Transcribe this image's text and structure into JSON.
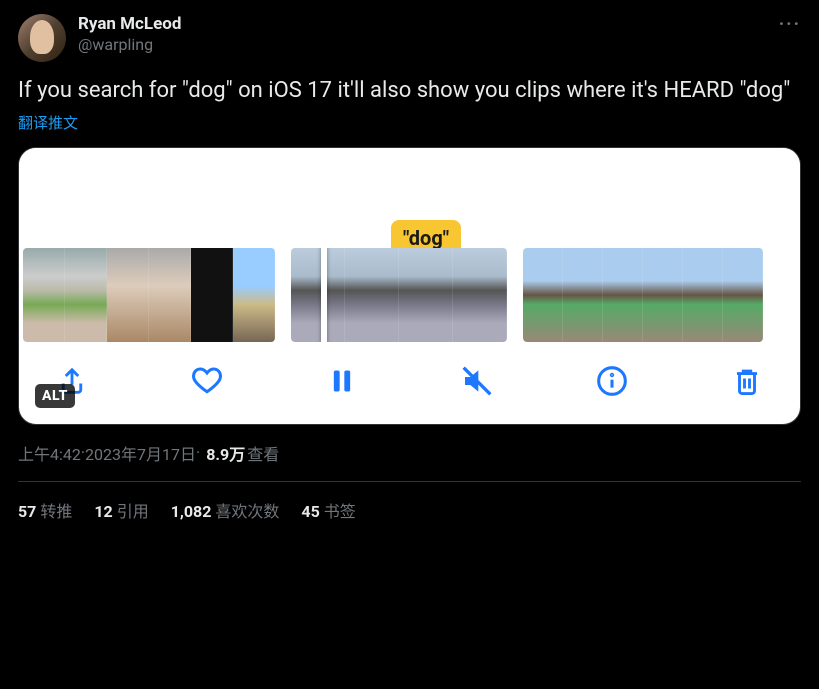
{
  "user": {
    "display_name": "Ryan McLeod",
    "handle": "@warpling"
  },
  "more_glyph": "···",
  "body": "If you search for \"dog\" on iOS 17 it'll also show you clips where it's HEARD \"dog\"",
  "translate": "翻译推文",
  "media": {
    "search_pill": "\"dog\"",
    "alt_badge": "ALT",
    "toolbar": {
      "share": "share",
      "heart": "heart",
      "pause": "pause",
      "mute": "mute",
      "info": "info",
      "trash": "trash"
    }
  },
  "meta": {
    "time": "上午4:42",
    "sep": " · ",
    "date": "2023年7月17日",
    "views_count": "8.9万",
    "views_label": " 查看"
  },
  "stats": {
    "retweets_count": "57",
    "retweets_label": "转推",
    "quotes_count": "12",
    "quotes_label": "引用",
    "likes_count": "1,082",
    "likes_label": "喜欢次数",
    "bookmarks_count": "45",
    "bookmarks_label": "书签"
  }
}
